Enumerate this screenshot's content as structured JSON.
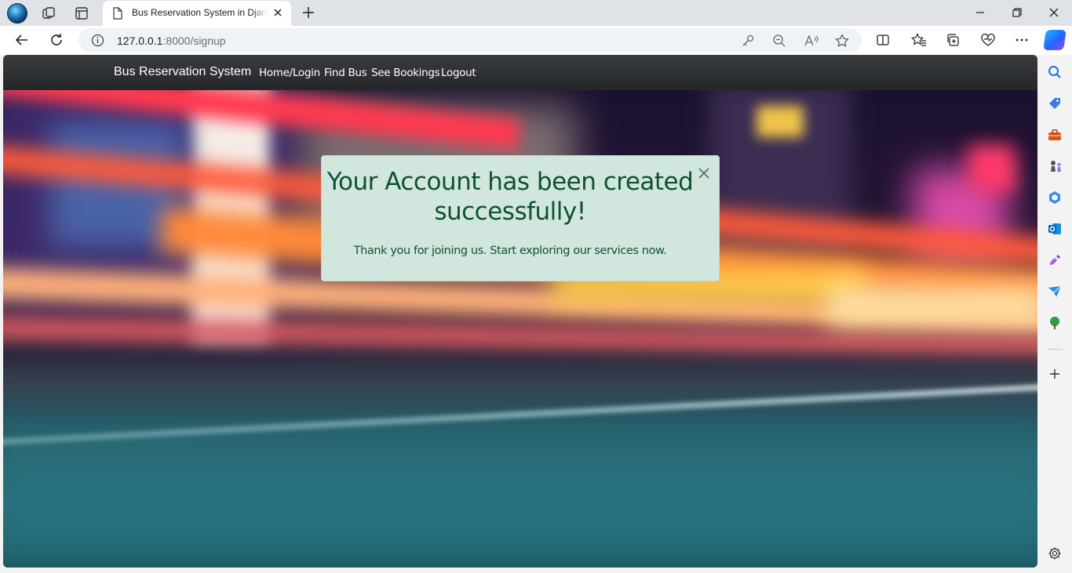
{
  "browser": {
    "tab_title": "Bus Reservation System in Django",
    "url_host": "127.0.0.1",
    "url_rest": ":8000/signup"
  },
  "navbar": {
    "brand": "Bus Reservation System",
    "links": [
      "Home/Login",
      "Find Bus",
      "See Bookings",
      "Logout"
    ]
  },
  "alert": {
    "heading": "Your Account has been created successfully!",
    "message": "Thank you for joining us. Start exploring our services now."
  },
  "colors": {
    "navbar": "#343a40",
    "alert_bg": "#d1e7dd",
    "alert_text": "#0f5132"
  },
  "icons": {
    "sidebar": [
      "search-icon",
      "tag-icon",
      "toolbox-icon",
      "chess-icon",
      "copilot-hex-icon",
      "outlook-icon",
      "designer-icon",
      "send-icon",
      "tree-icon",
      "add-icon",
      "settings-icon"
    ]
  }
}
